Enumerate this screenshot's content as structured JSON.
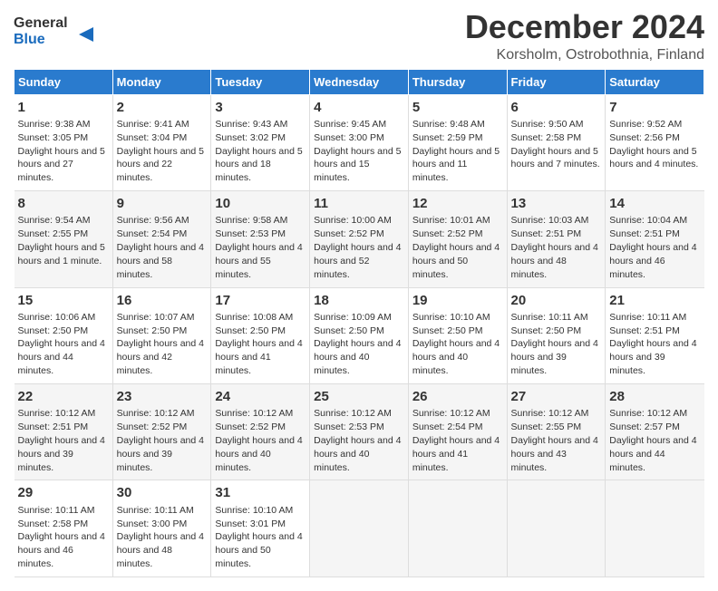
{
  "header": {
    "logo_line1": "General",
    "logo_line2": "Blue",
    "title": "December 2024",
    "subtitle": "Korsholm, Ostrobothnia, Finland"
  },
  "days_of_week": [
    "Sunday",
    "Monday",
    "Tuesday",
    "Wednesday",
    "Thursday",
    "Friday",
    "Saturday"
  ],
  "weeks": [
    [
      {
        "num": "1",
        "sunrise": "9:38 AM",
        "sunset": "3:05 PM",
        "daylight": "5 hours and 27 minutes."
      },
      {
        "num": "2",
        "sunrise": "9:41 AM",
        "sunset": "3:04 PM",
        "daylight": "5 hours and 22 minutes."
      },
      {
        "num": "3",
        "sunrise": "9:43 AM",
        "sunset": "3:02 PM",
        "daylight": "5 hours and 18 minutes."
      },
      {
        "num": "4",
        "sunrise": "9:45 AM",
        "sunset": "3:00 PM",
        "daylight": "5 hours and 15 minutes."
      },
      {
        "num": "5",
        "sunrise": "9:48 AM",
        "sunset": "2:59 PM",
        "daylight": "5 hours and 11 minutes."
      },
      {
        "num": "6",
        "sunrise": "9:50 AM",
        "sunset": "2:58 PM",
        "daylight": "5 hours and 7 minutes."
      },
      {
        "num": "7",
        "sunrise": "9:52 AM",
        "sunset": "2:56 PM",
        "daylight": "5 hours and 4 minutes."
      }
    ],
    [
      {
        "num": "8",
        "sunrise": "9:54 AM",
        "sunset": "2:55 PM",
        "daylight": "5 hours and 1 minute."
      },
      {
        "num": "9",
        "sunrise": "9:56 AM",
        "sunset": "2:54 PM",
        "daylight": "4 hours and 58 minutes."
      },
      {
        "num": "10",
        "sunrise": "9:58 AM",
        "sunset": "2:53 PM",
        "daylight": "4 hours and 55 minutes."
      },
      {
        "num": "11",
        "sunrise": "10:00 AM",
        "sunset": "2:52 PM",
        "daylight": "4 hours and 52 minutes."
      },
      {
        "num": "12",
        "sunrise": "10:01 AM",
        "sunset": "2:52 PM",
        "daylight": "4 hours and 50 minutes."
      },
      {
        "num": "13",
        "sunrise": "10:03 AM",
        "sunset": "2:51 PM",
        "daylight": "4 hours and 48 minutes."
      },
      {
        "num": "14",
        "sunrise": "10:04 AM",
        "sunset": "2:51 PM",
        "daylight": "4 hours and 46 minutes."
      }
    ],
    [
      {
        "num": "15",
        "sunrise": "10:06 AM",
        "sunset": "2:50 PM",
        "daylight": "4 hours and 44 minutes."
      },
      {
        "num": "16",
        "sunrise": "10:07 AM",
        "sunset": "2:50 PM",
        "daylight": "4 hours and 42 minutes."
      },
      {
        "num": "17",
        "sunrise": "10:08 AM",
        "sunset": "2:50 PM",
        "daylight": "4 hours and 41 minutes."
      },
      {
        "num": "18",
        "sunrise": "10:09 AM",
        "sunset": "2:50 PM",
        "daylight": "4 hours and 40 minutes."
      },
      {
        "num": "19",
        "sunrise": "10:10 AM",
        "sunset": "2:50 PM",
        "daylight": "4 hours and 40 minutes."
      },
      {
        "num": "20",
        "sunrise": "10:11 AM",
        "sunset": "2:50 PM",
        "daylight": "4 hours and 39 minutes."
      },
      {
        "num": "21",
        "sunrise": "10:11 AM",
        "sunset": "2:51 PM",
        "daylight": "4 hours and 39 minutes."
      }
    ],
    [
      {
        "num": "22",
        "sunrise": "10:12 AM",
        "sunset": "2:51 PM",
        "daylight": "4 hours and 39 minutes."
      },
      {
        "num": "23",
        "sunrise": "10:12 AM",
        "sunset": "2:52 PM",
        "daylight": "4 hours and 39 minutes."
      },
      {
        "num": "24",
        "sunrise": "10:12 AM",
        "sunset": "2:52 PM",
        "daylight": "4 hours and 40 minutes."
      },
      {
        "num": "25",
        "sunrise": "10:12 AM",
        "sunset": "2:53 PM",
        "daylight": "4 hours and 40 minutes."
      },
      {
        "num": "26",
        "sunrise": "10:12 AM",
        "sunset": "2:54 PM",
        "daylight": "4 hours and 41 minutes."
      },
      {
        "num": "27",
        "sunrise": "10:12 AM",
        "sunset": "2:55 PM",
        "daylight": "4 hours and 43 minutes."
      },
      {
        "num": "28",
        "sunrise": "10:12 AM",
        "sunset": "2:57 PM",
        "daylight": "4 hours and 44 minutes."
      }
    ],
    [
      {
        "num": "29",
        "sunrise": "10:11 AM",
        "sunset": "2:58 PM",
        "daylight": "4 hours and 46 minutes."
      },
      {
        "num": "30",
        "sunrise": "10:11 AM",
        "sunset": "3:00 PM",
        "daylight": "4 hours and 48 minutes."
      },
      {
        "num": "31",
        "sunrise": "10:10 AM",
        "sunset": "3:01 PM",
        "daylight": "4 hours and 50 minutes."
      },
      null,
      null,
      null,
      null
    ]
  ]
}
